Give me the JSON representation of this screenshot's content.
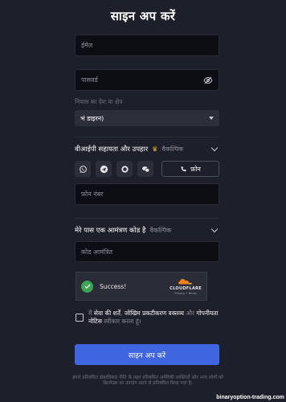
{
  "title": "साइन अप करें",
  "email": {
    "placeholder": "ईमेल"
  },
  "password": {
    "placeholder": "पासवर्ड"
  },
  "country": {
    "label": "निवास का देश या क्षेत्र",
    "selected": "भं डाइरन)"
  },
  "vip": {
    "title": "वीआईपी सहायता और उपहार",
    "crown": "♛",
    "optional": "वैकल्पिक"
  },
  "contact": {
    "phone_button": "फ़ोन",
    "phone_placeholder": "फ़ोन नंबर"
  },
  "invite": {
    "title": "मेरे पास एक आमंत्रण कोड है",
    "optional": "वैकल्पिक",
    "placeholder": "कोड आमंत्रित"
  },
  "captcha": {
    "status": "Success!",
    "brand": "CLOUDFLARE",
    "links": "Privacy  •  Terms"
  },
  "terms": {
    "text_1": "मैं",
    "link_1": "सेवा की शर्तें",
    "text_2": ",",
    "link_2": "जोखिम प्रकटीकरण वक्तव्य",
    "text_3": "और",
    "link_3": "गोपनीयता नोटिस",
    "text_4": "स्वीकार करता हूं।"
  },
  "submit": {
    "label": "साइन अप करें"
  },
  "disclaimer": "हमारे प्रतिबंधित क्षेत्राधिकार नीति के तहत प्रतिबंधित अमेरिकी व्यक्तियों और अन्य लोगों को बिटमेक्स का उपयोग करने से प्रतिबंधित किया गया है।",
  "watermark": "binaryoption-trading.com",
  "colors": {
    "background": "#1d1f2a",
    "input": "#0d0e13",
    "accent": "#3f66e0",
    "success": "#3ca454",
    "cloudflare": "#f48120"
  },
  "icons": [
    "eye-off-icon",
    "whatsapp-icon",
    "telegram-icon",
    "signal-icon",
    "wechat-icon",
    "phone-icon",
    "chevron-down-icon",
    "crown-icon",
    "check-icon",
    "cloudflare-logo"
  ]
}
